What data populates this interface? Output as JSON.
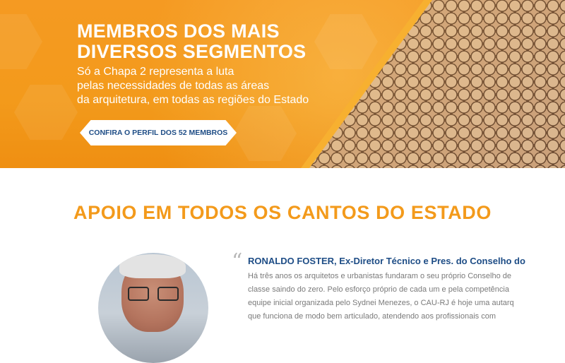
{
  "hero": {
    "title_lines": [
      "MEMBROS DOS MAIS",
      "DIVERSOS SEGMENTOS"
    ],
    "subtitle_lines": [
      "Só a Chapa 2 representa a luta",
      "pelas necessidades de todas as áreas",
      "da arquitetura, em todas as regiões do Estado"
    ],
    "cta_label": "CONFIRA O PERFIL DOS 52 MEMBROS",
    "colors": {
      "accent": "#f39a1b",
      "button_text": "#1e4d86",
      "background": "#ffffff"
    }
  },
  "section": {
    "title": "APOIO EM TODOS OS CANTOS DO ESTADO"
  },
  "testimonial": {
    "quote_icon": "quote-icon",
    "name": "RONALDO FOSTER, Ex-Diretor Técnico e Pres. do Conselho do",
    "body_lines": [
      "Há três anos os arquitetos e urbanistas fundaram o seu próprio Conselho de",
      "classe saindo do zero. Pelo esforço próprio de cada um e pela competência",
      "equipe inicial organizada pelo Sydnei Menezes, o CAU-RJ é hoje uma autarq",
      "que funciona de modo bem articulado, atendendo aos profissionais com"
    ]
  }
}
